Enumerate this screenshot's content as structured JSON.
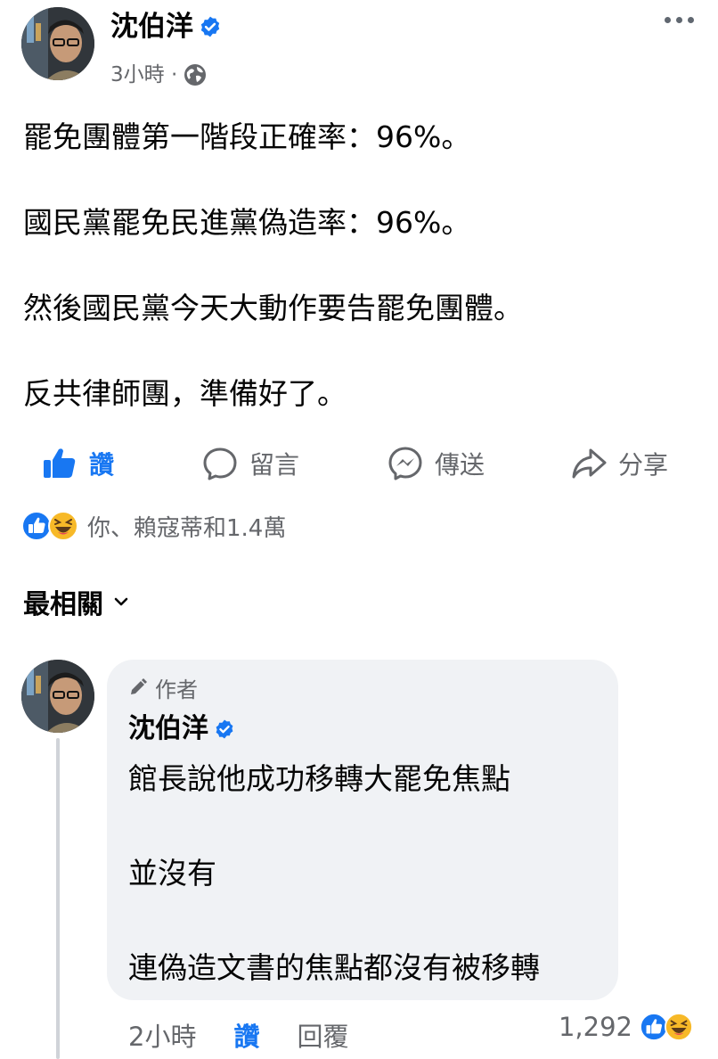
{
  "post": {
    "author": "沈伯洋",
    "time": "3小時 ·",
    "lines": [
      "罷免團體第一階段正確率：96%。",
      "國民黨罷免民進黨偽造率：96%。",
      "然後國民黨今天大動作要告罷免團體。",
      "反共律師團，準備好了。"
    ]
  },
  "actions": {
    "like": "讚",
    "comment": "留言",
    "send": "傳送",
    "share": "分享"
  },
  "reactions": {
    "summary": "你、賴寇蒂和1.4萬",
    "icons": [
      "like-icon",
      "haha-icon"
    ]
  },
  "sort": {
    "label": "最相關"
  },
  "comment": {
    "badge": "作者",
    "author": "沈伯洋",
    "lines": [
      "館長說他成功移轉大罷免焦點",
      "並沒有",
      "連偽造文書的焦點都沒有被移轉"
    ],
    "time": "2小時",
    "like": "讚",
    "reply": "回覆",
    "reaction_count": "1,292"
  },
  "colors": {
    "accent": "#1877f2",
    "secondary_text": "#65676b",
    "bubble": "#f0f2f5"
  }
}
